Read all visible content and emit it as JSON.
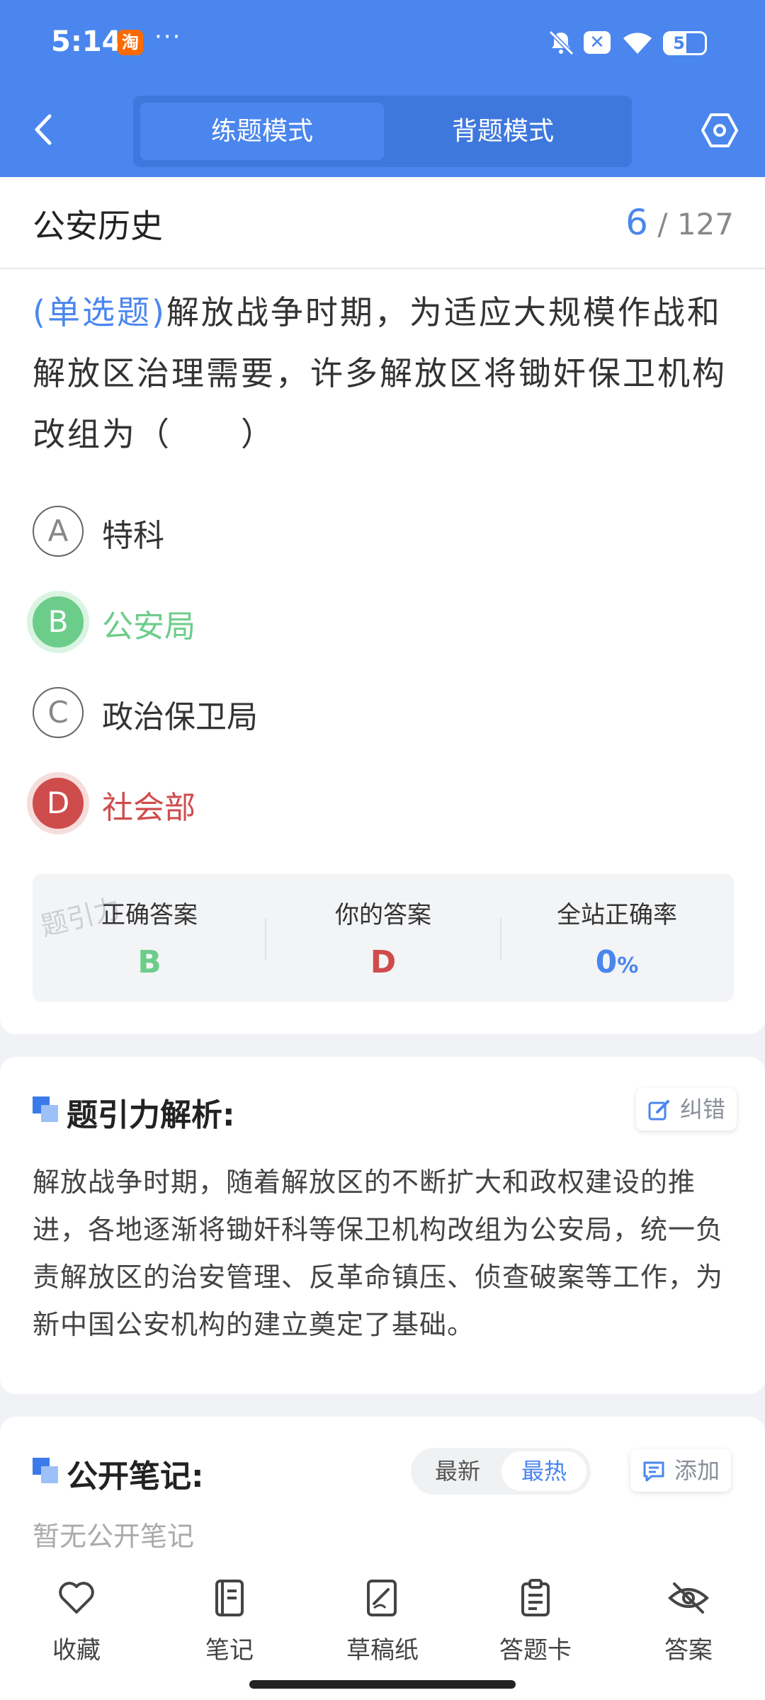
{
  "status_bar": {
    "time": "5:14",
    "app_badge": "淘",
    "dots": "···",
    "x_badge": "✕",
    "battery": "53",
    "battery_level": 0.53
  },
  "header": {
    "tabs": [
      {
        "label": "练题模式",
        "active": true
      },
      {
        "label": "背题模式",
        "active": false
      }
    ]
  },
  "question": {
    "subject": "公安历史",
    "current": "6",
    "total": "/ 127",
    "type_label": "(单选题)",
    "text": "解放战争时期，为适应大规模作战和解放区治理需要，许多解放区将锄奸保卫机构改组为（　　）",
    "options": [
      {
        "letter": "A",
        "text": "特科",
        "state": "normal"
      },
      {
        "letter": "B",
        "text": "公安局",
        "state": "correct"
      },
      {
        "letter": "C",
        "text": "政治保卫局",
        "state": "normal"
      },
      {
        "letter": "D",
        "text": "社会部",
        "state": "wrong"
      }
    ]
  },
  "result": {
    "watermark": "题引力",
    "correct_title": "正确答案",
    "correct_value": "B",
    "yours_title": "你的答案",
    "yours_value": "D",
    "rate_title": "全站正确率",
    "rate_value": "0",
    "rate_unit": "%",
    "colors": {
      "correct": "#6ccd8a",
      "wrong": "#cf4c4c",
      "accent": "#4a86ee"
    }
  },
  "analysis": {
    "title": "题引力解析:",
    "report_label": "纠错",
    "text": "解放战争时期，随着解放区的不断扩大和政权建设的推进，各地逐渐将锄奸科等保卫机构改组为公安局，统一负责解放区的治安管理、反革命镇压、侦查破案等工作，为新中国公安机构的建立奠定了基础。"
  },
  "notes": {
    "title": "公开笔记:",
    "sort_latest": "最新",
    "sort_hot": "最热",
    "add_label": "添加",
    "empty_text": "暂无公开笔记"
  },
  "bottom_bar": [
    {
      "label": "收藏",
      "icon": "heart-icon"
    },
    {
      "label": "笔记",
      "icon": "notebook-icon"
    },
    {
      "label": "草稿纸",
      "icon": "draft-icon"
    },
    {
      "label": "答题卡",
      "icon": "clipboard-icon"
    },
    {
      "label": "答案",
      "icon": "eye-off-icon"
    }
  ]
}
